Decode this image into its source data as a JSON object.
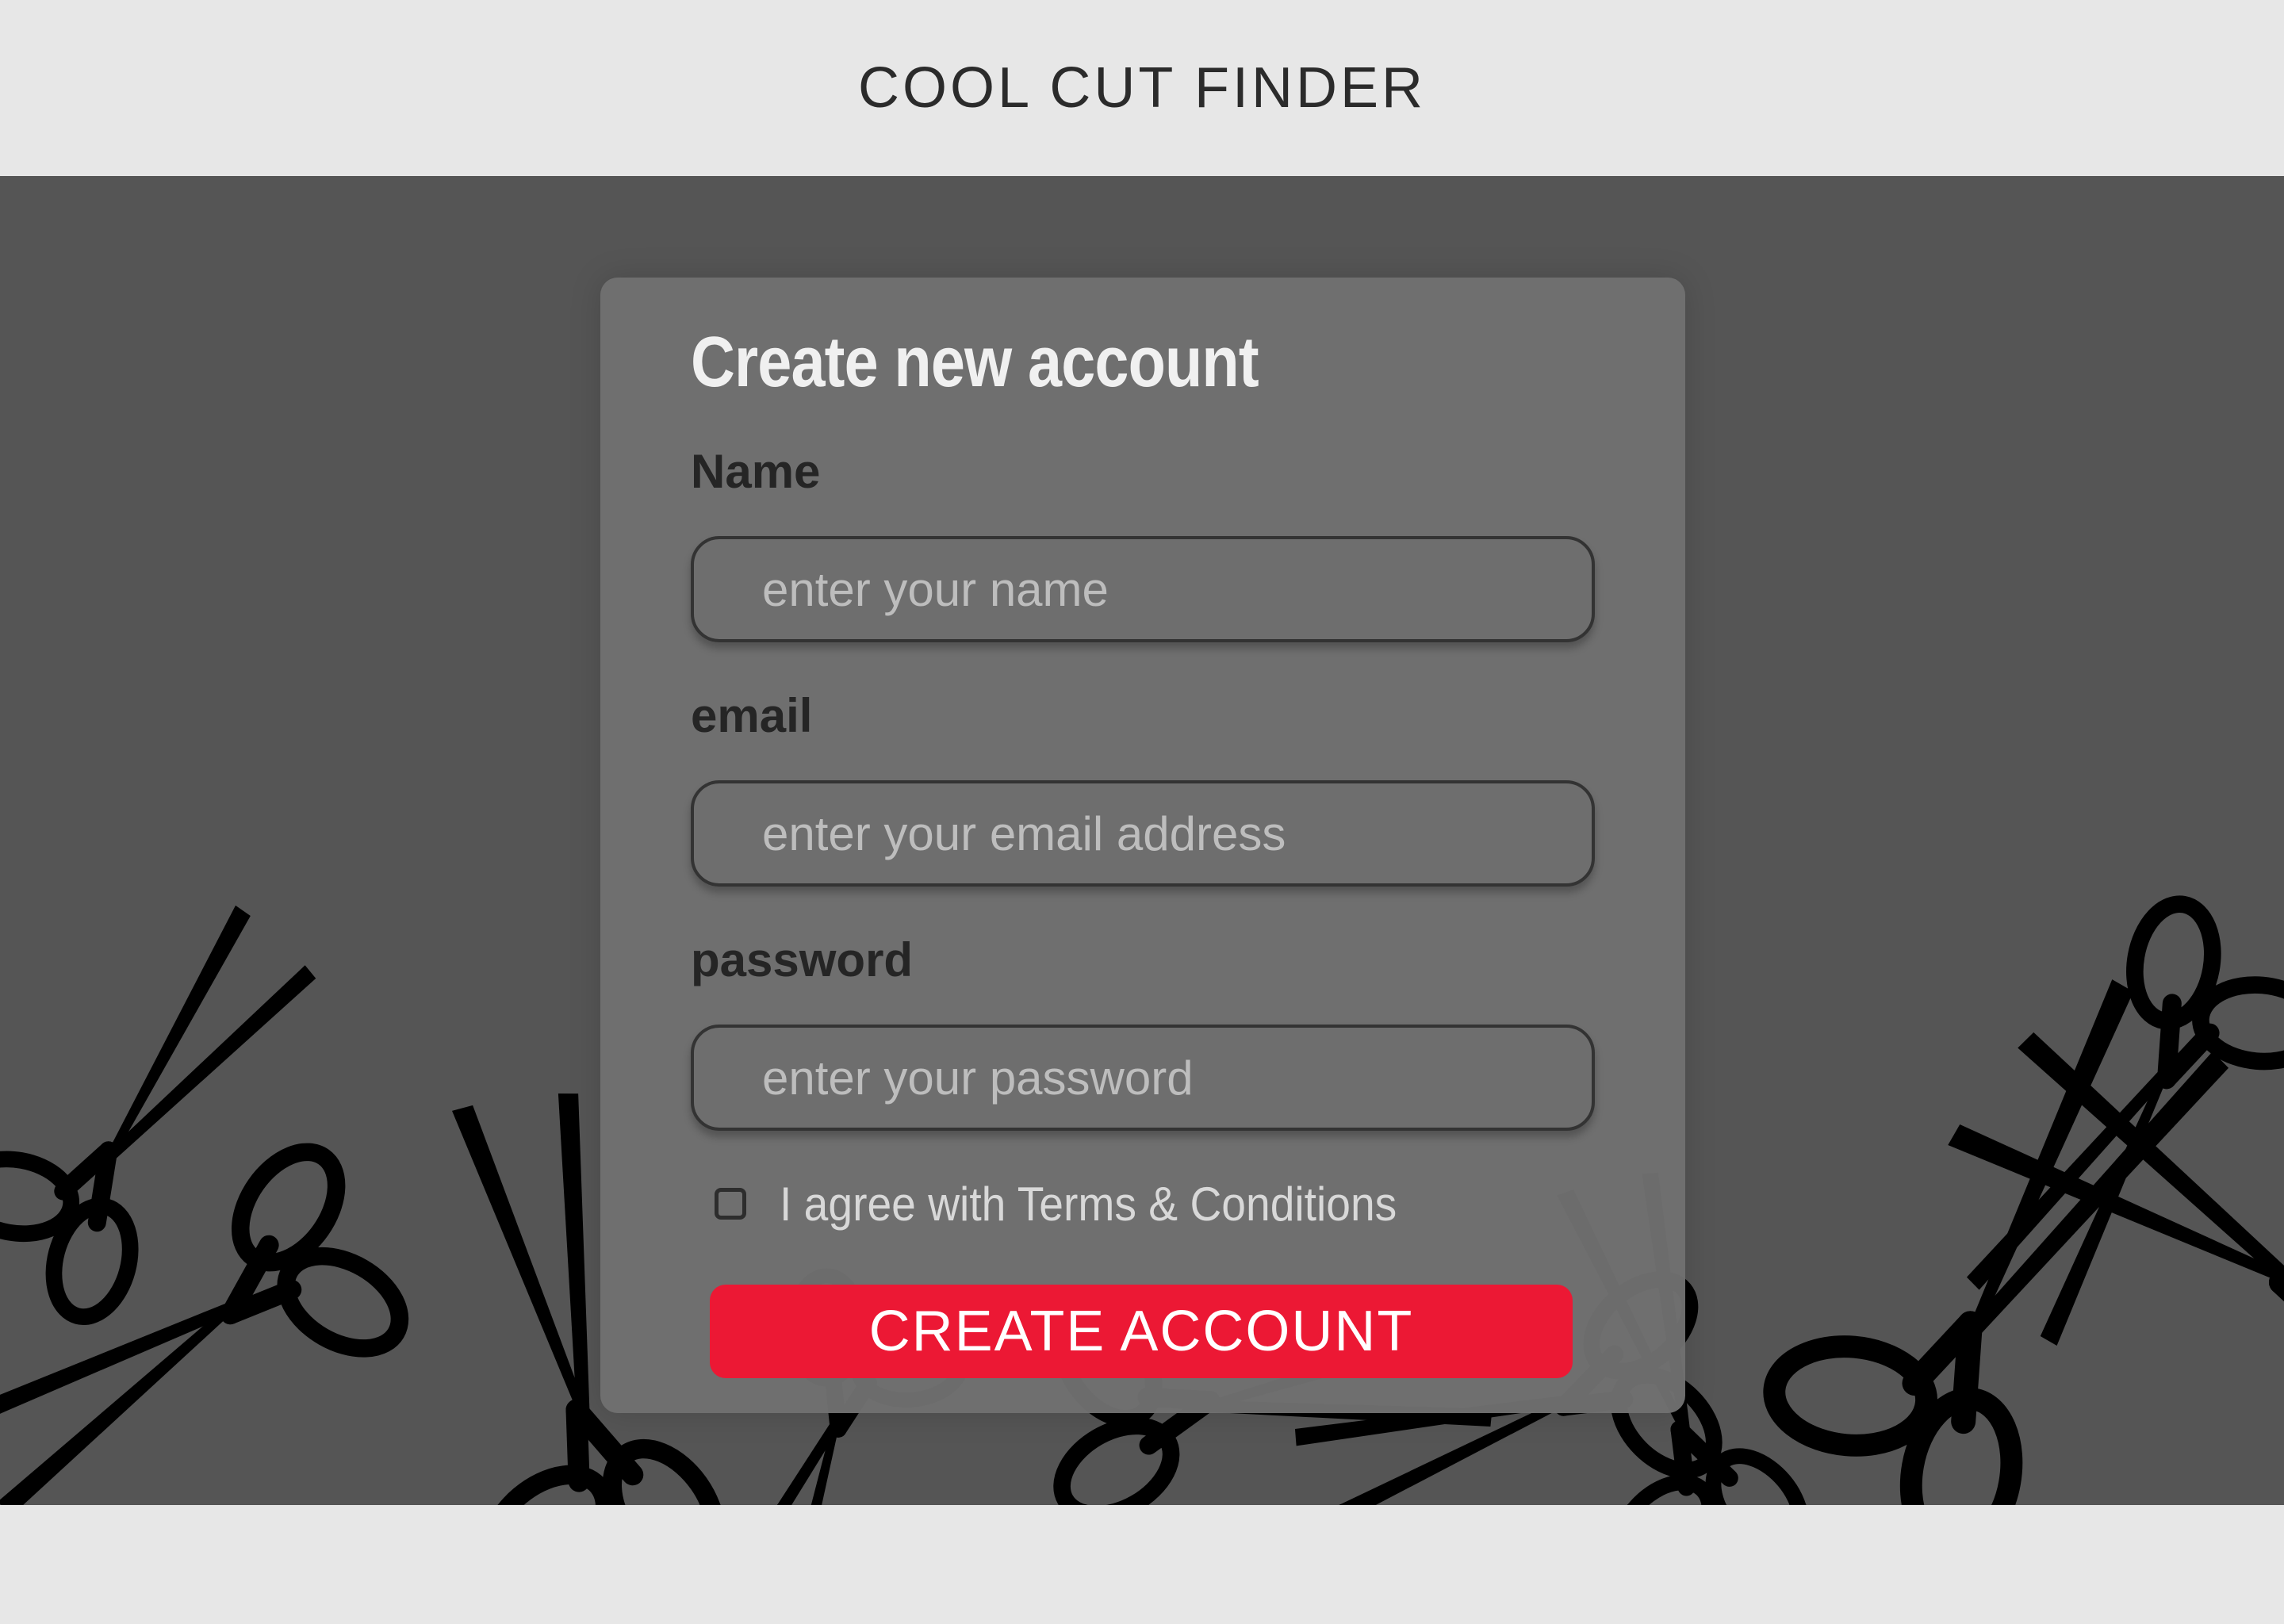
{
  "header": {
    "brand": "COOL CUT FINDER"
  },
  "form": {
    "title": "Create new account",
    "name": {
      "label": "Name",
      "placeholder": "enter your name",
      "value": ""
    },
    "email": {
      "label": "email",
      "placeholder": "enter your email address",
      "value": ""
    },
    "password": {
      "label": "password",
      "placeholder": "enter your password",
      "value": ""
    },
    "terms": {
      "label": "I agree with Terms & Conditions",
      "checked": false
    },
    "submit_label": "CREATE ACCOUNT"
  },
  "background": {
    "decoration_icon": "scissors-icon"
  },
  "colors": {
    "page_background": "#e7e7e7",
    "hero_background": "#555555",
    "card_background": "#707070",
    "title_text": "#f0f0f0",
    "label_text": "#252525",
    "placeholder_text": "#bdbdbd",
    "accent_button": "#ec1834"
  }
}
